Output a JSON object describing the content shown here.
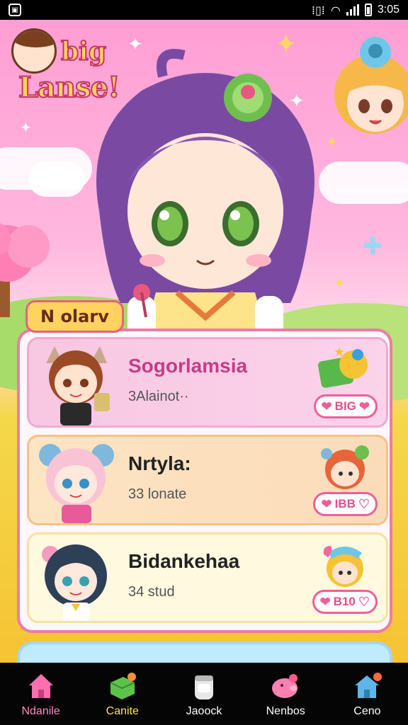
{
  "status_bar": {
    "time": "3:05",
    "app_icon": "gallery-icon"
  },
  "logo": {
    "line1": "big",
    "line2": "Lanse!"
  },
  "section": {
    "tag": "N olarv"
  },
  "list": [
    {
      "title": "Sogorlamsia",
      "subtitle": "3Alainot··",
      "badge": "BIG"
    },
    {
      "title": "Nrtyla:",
      "subtitle": "33 lonate",
      "badge": "IBB"
    },
    {
      "title": "Bidankehaa",
      "subtitle": "34 stud",
      "badge": "B10"
    }
  ],
  "nav": [
    {
      "label": "Ndanile",
      "icon": "home-icon"
    },
    {
      "label": "Canite",
      "icon": "favorite-cube-icon"
    },
    {
      "label": "Jaoock",
      "icon": "jar-icon"
    },
    {
      "label": "Nenbos",
      "icon": "pig-icon"
    },
    {
      "label": "Ceno",
      "icon": "house-icon"
    }
  ],
  "colors": {
    "accent": "#ef5e98",
    "panel_border": "#ef7aa6",
    "sky": "#ff9ed4"
  }
}
